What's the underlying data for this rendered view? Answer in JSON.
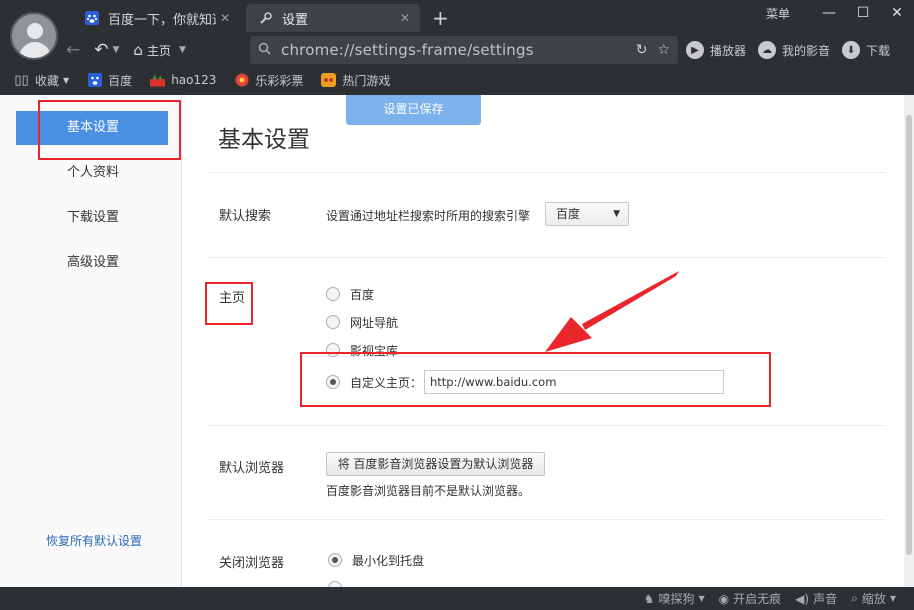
{
  "tabs": [
    {
      "label": "百度一下，你就知道",
      "close": "✕"
    },
    {
      "label": "设置",
      "close": "✕"
    }
  ],
  "new_tab": "+",
  "window": {
    "menu_label": "菜单",
    "min": "—",
    "max": "☐",
    "close": "✕"
  },
  "nav": {
    "home_label": "主页"
  },
  "url": {
    "value": "chrome://settings-frame/settings"
  },
  "right_tools": [
    {
      "label": "播放器",
      "icon": "play-icon"
    },
    {
      "label": "我的影音",
      "icon": "cloud-icon"
    },
    {
      "label": "下载",
      "icon": "download-icon"
    }
  ],
  "bookmarks": [
    {
      "label": "收藏",
      "icon": "book-icon"
    },
    {
      "label": "百度",
      "icon": "baidu-paw-icon"
    },
    {
      "label": "hao123",
      "icon": "hao123-icon"
    },
    {
      "label": "乐彩彩票",
      "icon": "lottery-icon"
    },
    {
      "label": "热门游戏",
      "icon": "game-icon"
    }
  ],
  "sidebar": {
    "items": [
      {
        "label": "基本设置",
        "active": true
      },
      {
        "label": "个人资料"
      },
      {
        "label": "下载设置"
      },
      {
        "label": "高级设置"
      }
    ],
    "restore_label": "恢复所有默认设置"
  },
  "main": {
    "toast": "设置已保存",
    "title": "基本设置",
    "search": {
      "label": "默认搜索",
      "desc": "设置通过地址栏搜索时所用的搜索引擎",
      "selected": "百度"
    },
    "homepage": {
      "label": "主页",
      "options": [
        "百度",
        "网址导航",
        "影视宝库",
        "自定义主页："
      ],
      "selected_index": 3,
      "custom_url": "http://www.baidu.com"
    },
    "default_browser": {
      "label": "默认浏览器",
      "button": "将 百度影音浏览器设置为默认浏览器",
      "status": "百度影音浏览器目前不是默认浏览器。"
    },
    "close_browser": {
      "label": "关闭浏览器",
      "option": "最小化到托盘"
    }
  },
  "statusbar": [
    {
      "label": "嗅探狗",
      "icon": "dog-icon",
      "caret": true
    },
    {
      "label": "开启无痕",
      "icon": "eye-icon"
    },
    {
      "label": "声音",
      "icon": "speaker-icon"
    },
    {
      "label": "缩放",
      "icon": "zoom-icon",
      "caret": true
    }
  ],
  "colors": {
    "accent": "#4a90e2",
    "annotation": "#e8262c",
    "chrome": "#2d3033"
  }
}
